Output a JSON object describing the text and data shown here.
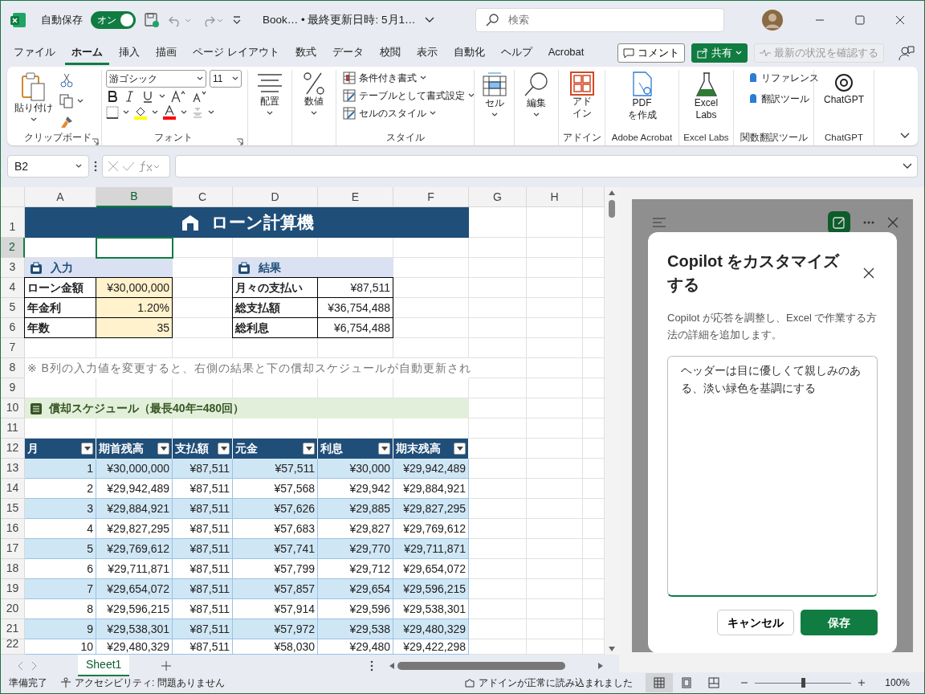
{
  "title_bar": {
    "autosave_label": "自動保存",
    "autosave_toggle": {
      "label": "オン",
      "on": true
    },
    "document_title": "Book… • 最終更新日時: 5月1…",
    "search": {
      "placeholder": "検索"
    }
  },
  "menu_tabs": [
    {
      "label": "ファイル",
      "selected": false
    },
    {
      "label": "ホーム",
      "selected": true
    },
    {
      "label": "挿入",
      "selected": false
    },
    {
      "label": "描画",
      "selected": false
    },
    {
      "label": "ページ レイアウト",
      "selected": false
    },
    {
      "label": "数式",
      "selected": false
    },
    {
      "label": "データ",
      "selected": false
    },
    {
      "label": "校閲",
      "selected": false
    },
    {
      "label": "表示",
      "selected": false
    },
    {
      "label": "自動化",
      "selected": false
    },
    {
      "label": "ヘルプ",
      "selected": false
    },
    {
      "label": "Acrobat",
      "selected": false
    }
  ],
  "header_buttons": {
    "comment": "コメント",
    "share": "共有",
    "catch_up": {
      "label": "最新の状況を確認する",
      "disabled": true
    }
  },
  "ribbon": {
    "groups": [
      {
        "label": "クリップボード",
        "items": [
          {
            "label": "貼り付け"
          }
        ]
      },
      {
        "label": "フォント",
        "items": [
          {
            "label": "游ゴシック"
          },
          {
            "label": "11"
          }
        ]
      },
      {
        "items": [
          {
            "label": "配置"
          }
        ]
      },
      {
        "items": [
          {
            "label": "数値"
          }
        ]
      },
      {
        "label": "スタイル",
        "items": [
          {
            "label": "条件付き書式"
          },
          {
            "label": "テーブルとして書式設定"
          },
          {
            "label": "セルのスタイル"
          }
        ]
      },
      {
        "items": [
          {
            "label": "セル"
          }
        ]
      },
      {
        "items": [
          {
            "label": "編集"
          }
        ]
      },
      {
        "label": "アドイン",
        "items": [
          {
            "label": "アドイン"
          }
        ]
      },
      {
        "label": "Adobe Acrobat",
        "items": [
          {
            "label": "PDF を作成"
          }
        ]
      },
      {
        "label": "Excel Labs",
        "items": [
          {
            "label": "Excel Labs"
          }
        ]
      },
      {
        "label": "関数翻訳ツール",
        "items": [
          {
            "label": "リファレンス"
          },
          {
            "label": "翻訳ツール"
          }
        ]
      },
      {
        "label": "ChatGPT",
        "items": [
          {
            "label": "ChatGPT"
          }
        ]
      }
    ]
  },
  "formula_bar": {
    "name_box": "B2"
  },
  "sheet": {
    "columns": [
      {
        "label": "A",
        "selected": false
      },
      {
        "label": "B",
        "selected": true
      },
      {
        "label": "C",
        "selected": false
      },
      {
        "label": "D",
        "selected": false
      },
      {
        "label": "E",
        "selected": false
      },
      {
        "label": "F",
        "selected": false
      },
      {
        "label": "G",
        "selected": false
      },
      {
        "label": "H",
        "selected": false
      }
    ],
    "row_numbers": [
      {
        "label": "1",
        "selected": false
      },
      {
        "label": "2",
        "selected": true
      },
      {
        "label": "3",
        "selected": false
      },
      {
        "label": "4",
        "selected": false
      },
      {
        "label": "5",
        "selected": false
      },
      {
        "label": "6",
        "selected": false
      },
      {
        "label": "7",
        "selected": false
      },
      {
        "label": "8",
        "selected": false
      },
      {
        "label": "9",
        "selected": false
      },
      {
        "label": "10",
        "selected": false
      },
      {
        "label": "11",
        "selected": false
      },
      {
        "label": "12",
        "selected": false
      },
      {
        "label": "13",
        "selected": false
      },
      {
        "label": "14",
        "selected": false
      },
      {
        "label": "15",
        "selected": false
      },
      {
        "label": "16",
        "selected": false
      },
      {
        "label": "17",
        "selected": false
      },
      {
        "label": "18",
        "selected": false
      },
      {
        "label": "19",
        "selected": false
      },
      {
        "label": "20",
        "selected": false
      },
      {
        "label": "21",
        "selected": false
      },
      {
        "label": "22",
        "selected": false
      }
    ],
    "title": "ローン計算機",
    "input": {
      "header": "入力",
      "rows": [
        {
          "label": "ローン金額",
          "value": "¥30,000,000"
        },
        {
          "label": "年金利",
          "value": "1.20%"
        },
        {
          "label": "年数",
          "value": "35"
        }
      ]
    },
    "result": {
      "header": "結果",
      "rows": [
        {
          "label": "月々の支払い",
          "value": "¥87,511"
        },
        {
          "label": "総支払額",
          "value": "¥36,754,488"
        },
        {
          "label": "総利息",
          "value": "¥6,754,488"
        }
      ]
    },
    "note": "※ B列の入力値を変更すると、右側の結果と下の償却スケジュールが自動更新され",
    "schedule_title": "償却スケジュール（最長40年=480回）",
    "schedule": {
      "columns": [
        "月",
        "期首残高",
        "支払額",
        "元金",
        "利息",
        "期末残高"
      ],
      "rows": [
        [
          "1",
          "¥30,000,000",
          "¥87,511",
          "¥57,511",
          "¥30,000",
          "¥29,942,489"
        ],
        [
          "2",
          "¥29,942,489",
          "¥87,511",
          "¥57,568",
          "¥29,942",
          "¥29,884,921"
        ],
        [
          "3",
          "¥29,884,921",
          "¥87,511",
          "¥57,626",
          "¥29,885",
          "¥29,827,295"
        ],
        [
          "4",
          "¥29,827,295",
          "¥87,511",
          "¥57,683",
          "¥29,827",
          "¥29,769,612"
        ],
        [
          "5",
          "¥29,769,612",
          "¥87,511",
          "¥57,741",
          "¥29,770",
          "¥29,711,871"
        ],
        [
          "6",
          "¥29,711,871",
          "¥87,511",
          "¥57,799",
          "¥29,712",
          "¥29,654,072"
        ],
        [
          "7",
          "¥29,654,072",
          "¥87,511",
          "¥57,857",
          "¥29,654",
          "¥29,596,215"
        ],
        [
          "8",
          "¥29,596,215",
          "¥87,511",
          "¥57,914",
          "¥29,596",
          "¥29,538,301"
        ],
        [
          "9",
          "¥29,538,301",
          "¥87,511",
          "¥57,972",
          "¥29,538",
          "¥29,480,329"
        ],
        [
          "10",
          "¥29,480,329",
          "¥87,511",
          "¥58,030",
          "¥29,480",
          "¥29,422,298"
        ]
      ]
    }
  },
  "sheet_tabs": [
    {
      "label": "Sheet1",
      "selected": true
    }
  ],
  "copilot": {
    "dialog": {
      "title": "Copilot をカスタマイズする",
      "description": "Copilot が応答を調整し、Excel で作業する方法の詳細を追加します。",
      "instructions": "ヘッダーは目に優しくて親しみのある、淡い緑色を基調にする",
      "cancel": "キャンセル",
      "save": "保存"
    }
  },
  "status_bar": {
    "ready": "準備完了",
    "accessibility": "アクセシビリティ: 問題ありません",
    "addins": "アドインが正常に読み込まれました",
    "views": [
      {
        "selected": true
      },
      {
        "selected": false
      },
      {
        "selected": false
      }
    ],
    "zoom_slider": {
      "level": 0.5
    },
    "zoom": "100%"
  }
}
